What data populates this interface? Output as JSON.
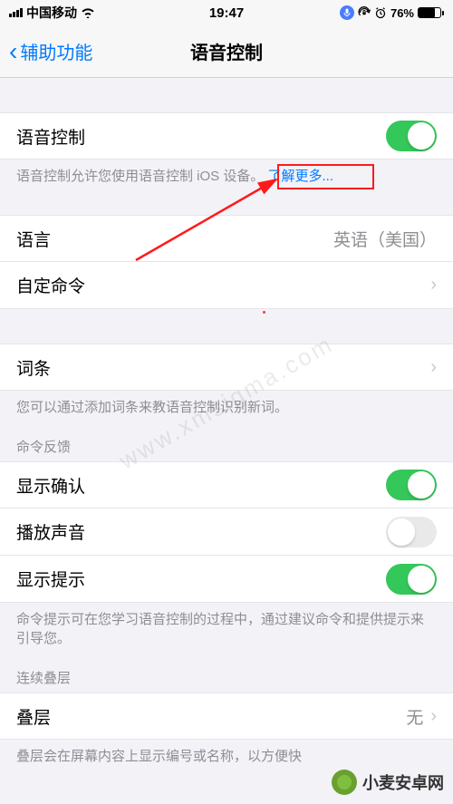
{
  "status": {
    "carrier": "中国移动",
    "time": "19:47",
    "battery_pct": "76%"
  },
  "nav": {
    "back": "辅助功能",
    "title": "语音控制"
  },
  "main_toggle": {
    "label": "语音控制",
    "on": true,
    "footer_pre": "语音控制允许您使用语音控制 iOS 设备。",
    "footer_link": "了解更多..."
  },
  "language_row": {
    "label": "语言",
    "value": "英语（美国）"
  },
  "custom_cmd_row": {
    "label": "自定命令"
  },
  "vocab_row": {
    "label": "词条",
    "footer": "您可以通过添加词条来教语音控制识别新词。"
  },
  "feedback": {
    "header": "命令反馈",
    "confirm": {
      "label": "显示确认",
      "on": true
    },
    "sound": {
      "label": "播放声音",
      "on": false
    },
    "hint": {
      "label": "显示提示",
      "on": true
    },
    "footer": "命令提示可在您学习语音控制的过程中，通过建议命令和提供提示来引导您。"
  },
  "overlay": {
    "header": "连续叠层",
    "row_label": "叠层",
    "row_value": "无",
    "footer": "叠层会在屏幕内容上显示编号或名称，以方便快"
  },
  "watermark": "www.xmsigma.com",
  "brand": "小麦安卓网"
}
